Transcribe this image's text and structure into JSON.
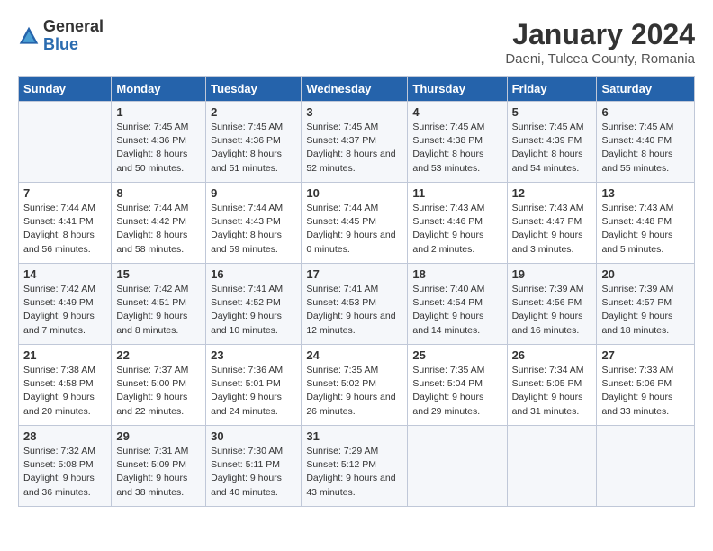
{
  "header": {
    "logo_general": "General",
    "logo_blue": "Blue",
    "month_title": "January 2024",
    "subtitle": "Daeni, Tulcea County, Romania"
  },
  "weekdays": [
    "Sunday",
    "Monday",
    "Tuesday",
    "Wednesday",
    "Thursday",
    "Friday",
    "Saturday"
  ],
  "weeks": [
    [
      {
        "day": "",
        "sunrise": "",
        "sunset": "",
        "daylight": ""
      },
      {
        "day": "1",
        "sunrise": "Sunrise: 7:45 AM",
        "sunset": "Sunset: 4:36 PM",
        "daylight": "Daylight: 8 hours and 50 minutes."
      },
      {
        "day": "2",
        "sunrise": "Sunrise: 7:45 AM",
        "sunset": "Sunset: 4:36 PM",
        "daylight": "Daylight: 8 hours and 51 minutes."
      },
      {
        "day": "3",
        "sunrise": "Sunrise: 7:45 AM",
        "sunset": "Sunset: 4:37 PM",
        "daylight": "Daylight: 8 hours and 52 minutes."
      },
      {
        "day": "4",
        "sunrise": "Sunrise: 7:45 AM",
        "sunset": "Sunset: 4:38 PM",
        "daylight": "Daylight: 8 hours and 53 minutes."
      },
      {
        "day": "5",
        "sunrise": "Sunrise: 7:45 AM",
        "sunset": "Sunset: 4:39 PM",
        "daylight": "Daylight: 8 hours and 54 minutes."
      },
      {
        "day": "6",
        "sunrise": "Sunrise: 7:45 AM",
        "sunset": "Sunset: 4:40 PM",
        "daylight": "Daylight: 8 hours and 55 minutes."
      }
    ],
    [
      {
        "day": "7",
        "sunrise": "Sunrise: 7:44 AM",
        "sunset": "Sunset: 4:41 PM",
        "daylight": "Daylight: 8 hours and 56 minutes."
      },
      {
        "day": "8",
        "sunrise": "Sunrise: 7:44 AM",
        "sunset": "Sunset: 4:42 PM",
        "daylight": "Daylight: 8 hours and 58 minutes."
      },
      {
        "day": "9",
        "sunrise": "Sunrise: 7:44 AM",
        "sunset": "Sunset: 4:43 PM",
        "daylight": "Daylight: 8 hours and 59 minutes."
      },
      {
        "day": "10",
        "sunrise": "Sunrise: 7:44 AM",
        "sunset": "Sunset: 4:45 PM",
        "daylight": "Daylight: 9 hours and 0 minutes."
      },
      {
        "day": "11",
        "sunrise": "Sunrise: 7:43 AM",
        "sunset": "Sunset: 4:46 PM",
        "daylight": "Daylight: 9 hours and 2 minutes."
      },
      {
        "day": "12",
        "sunrise": "Sunrise: 7:43 AM",
        "sunset": "Sunset: 4:47 PM",
        "daylight": "Daylight: 9 hours and 3 minutes."
      },
      {
        "day": "13",
        "sunrise": "Sunrise: 7:43 AM",
        "sunset": "Sunset: 4:48 PM",
        "daylight": "Daylight: 9 hours and 5 minutes."
      }
    ],
    [
      {
        "day": "14",
        "sunrise": "Sunrise: 7:42 AM",
        "sunset": "Sunset: 4:49 PM",
        "daylight": "Daylight: 9 hours and 7 minutes."
      },
      {
        "day": "15",
        "sunrise": "Sunrise: 7:42 AM",
        "sunset": "Sunset: 4:51 PM",
        "daylight": "Daylight: 9 hours and 8 minutes."
      },
      {
        "day": "16",
        "sunrise": "Sunrise: 7:41 AM",
        "sunset": "Sunset: 4:52 PM",
        "daylight": "Daylight: 9 hours and 10 minutes."
      },
      {
        "day": "17",
        "sunrise": "Sunrise: 7:41 AM",
        "sunset": "Sunset: 4:53 PM",
        "daylight": "Daylight: 9 hours and 12 minutes."
      },
      {
        "day": "18",
        "sunrise": "Sunrise: 7:40 AM",
        "sunset": "Sunset: 4:54 PM",
        "daylight": "Daylight: 9 hours and 14 minutes."
      },
      {
        "day": "19",
        "sunrise": "Sunrise: 7:39 AM",
        "sunset": "Sunset: 4:56 PM",
        "daylight": "Daylight: 9 hours and 16 minutes."
      },
      {
        "day": "20",
        "sunrise": "Sunrise: 7:39 AM",
        "sunset": "Sunset: 4:57 PM",
        "daylight": "Daylight: 9 hours and 18 minutes."
      }
    ],
    [
      {
        "day": "21",
        "sunrise": "Sunrise: 7:38 AM",
        "sunset": "Sunset: 4:58 PM",
        "daylight": "Daylight: 9 hours and 20 minutes."
      },
      {
        "day": "22",
        "sunrise": "Sunrise: 7:37 AM",
        "sunset": "Sunset: 5:00 PM",
        "daylight": "Daylight: 9 hours and 22 minutes."
      },
      {
        "day": "23",
        "sunrise": "Sunrise: 7:36 AM",
        "sunset": "Sunset: 5:01 PM",
        "daylight": "Daylight: 9 hours and 24 minutes."
      },
      {
        "day": "24",
        "sunrise": "Sunrise: 7:35 AM",
        "sunset": "Sunset: 5:02 PM",
        "daylight": "Daylight: 9 hours and 26 minutes."
      },
      {
        "day": "25",
        "sunrise": "Sunrise: 7:35 AM",
        "sunset": "Sunset: 5:04 PM",
        "daylight": "Daylight: 9 hours and 29 minutes."
      },
      {
        "day": "26",
        "sunrise": "Sunrise: 7:34 AM",
        "sunset": "Sunset: 5:05 PM",
        "daylight": "Daylight: 9 hours and 31 minutes."
      },
      {
        "day": "27",
        "sunrise": "Sunrise: 7:33 AM",
        "sunset": "Sunset: 5:06 PM",
        "daylight": "Daylight: 9 hours and 33 minutes."
      }
    ],
    [
      {
        "day": "28",
        "sunrise": "Sunrise: 7:32 AM",
        "sunset": "Sunset: 5:08 PM",
        "daylight": "Daylight: 9 hours and 36 minutes."
      },
      {
        "day": "29",
        "sunrise": "Sunrise: 7:31 AM",
        "sunset": "Sunset: 5:09 PM",
        "daylight": "Daylight: 9 hours and 38 minutes."
      },
      {
        "day": "30",
        "sunrise": "Sunrise: 7:30 AM",
        "sunset": "Sunset: 5:11 PM",
        "daylight": "Daylight: 9 hours and 40 minutes."
      },
      {
        "day": "31",
        "sunrise": "Sunrise: 7:29 AM",
        "sunset": "Sunset: 5:12 PM",
        "daylight": "Daylight: 9 hours and 43 minutes."
      },
      {
        "day": "",
        "sunrise": "",
        "sunset": "",
        "daylight": ""
      },
      {
        "day": "",
        "sunrise": "",
        "sunset": "",
        "daylight": ""
      },
      {
        "day": "",
        "sunrise": "",
        "sunset": "",
        "daylight": ""
      }
    ]
  ]
}
